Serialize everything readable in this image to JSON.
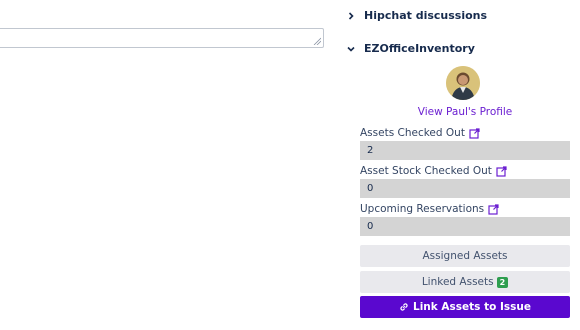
{
  "sections": {
    "hipchat": {
      "title": "Hipchat discussions",
      "expanded": false
    },
    "ezo": {
      "title": "EZOfficeInventory",
      "expanded": true
    }
  },
  "profile": {
    "link_text": "View Paul's Profile"
  },
  "fields": [
    {
      "label": "Assets Checked Out",
      "value": "2"
    },
    {
      "label": "Asset Stock Checked Out",
      "value": "0"
    },
    {
      "label": "Upcoming Reservations",
      "value": "0"
    }
  ],
  "buttons": {
    "assigned_assets": "Assigned Assets",
    "linked_assets": "Linked Assets",
    "linked_assets_count": "2",
    "link_to_issue": "Link Assets to Issue"
  },
  "colors": {
    "accent": "#5a08cf",
    "link": "#6b1fd1",
    "badge": "#2e9e4f",
    "field_bg": "#d4d4d4"
  },
  "icons": {
    "collapsed_section": "chevron-right-icon",
    "expanded_section": "chevron-down-icon",
    "external": "external-link-icon",
    "link": "link-icon",
    "grip": "resize-grip-icon"
  }
}
